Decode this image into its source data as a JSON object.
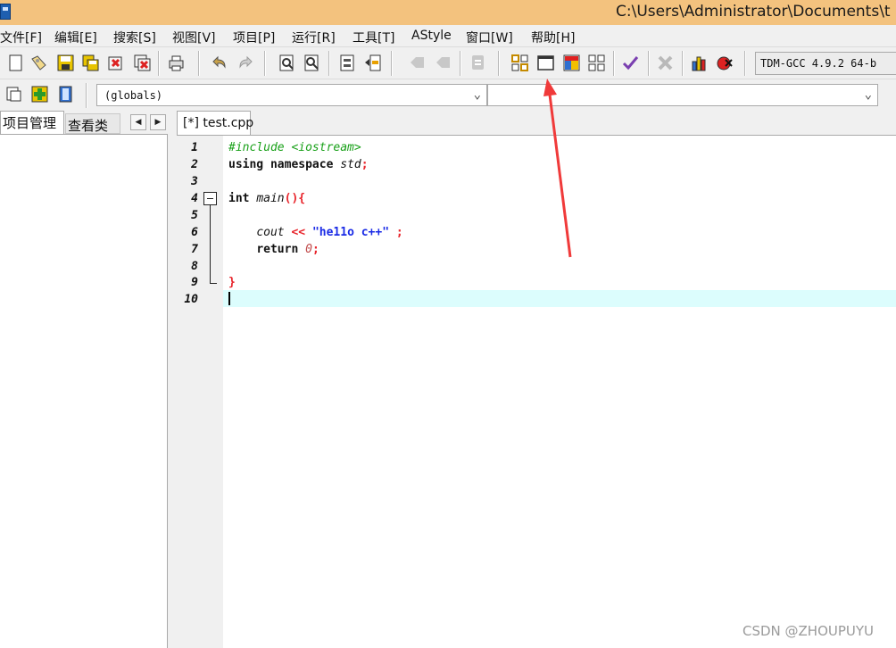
{
  "titlebar": {
    "title": "C:\\Users\\Administrator\\Documents\\t"
  },
  "menu": {
    "items": [
      "文件[F]",
      "编辑[E]",
      "搜索[S]",
      "视图[V]",
      "项目[P]",
      "运行[R]",
      "工具[T]",
      "AStyle",
      "窗口[W]",
      "帮助[H]"
    ]
  },
  "toolbar": {
    "compiler": "TDM-GCC 4.9.2 64-b",
    "icons": [
      "new-file",
      "open-file",
      "save",
      "save-all",
      "close",
      "close-all",
      "print",
      "undo",
      "redo",
      "find",
      "replace",
      "indent",
      "unindent",
      "goto-back",
      "goto-forward",
      "bookmark",
      "layout-grid",
      "layout-window",
      "layout-color",
      "layout-tiles",
      "check",
      "remove",
      "chart",
      "debug-stop"
    ]
  },
  "toolbar2": {
    "scope": "(globals)",
    "symbol": ""
  },
  "left_panel": {
    "tabs": [
      "项目管理",
      "查看类"
    ]
  },
  "editor": {
    "file_tab": "[*] test.cpp",
    "line_numbers": [
      "1",
      "2",
      "3",
      "4",
      "5",
      "6",
      "7",
      "8",
      "9",
      "10"
    ],
    "code": {
      "l1": "#include <iostream>",
      "l2_kw1": "using",
      "l2_kw2": "namespace",
      "l2_id": "std",
      "l2_sym": ";",
      "l4_kw": "int",
      "l4_id": "main",
      "l4_sym": "(){",
      "l6_id": "cout",
      "l6_op": "<<",
      "l6_str": "\"he11o c++\"",
      "l6_sym": ";",
      "l7_kw": "return",
      "l7_num": "0",
      "l7_sym": ";",
      "l9_sym": "}"
    }
  },
  "watermark": "CSDN @ZHOUPUYU",
  "colors": {
    "titlebar": "#f3c27e",
    "current_line": "#dcfdfd",
    "preprocessor": "#18a018",
    "string": "#1a2be6",
    "symbol": "#e8232a",
    "annotation_arrow": "#f03a3a"
  }
}
